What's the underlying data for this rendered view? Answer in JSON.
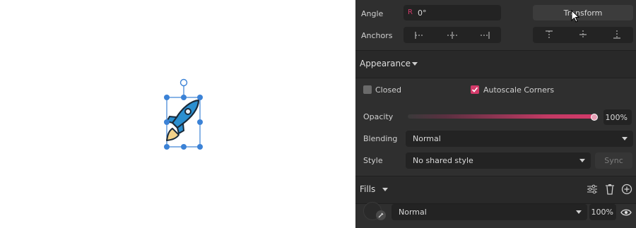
{
  "transform": {
    "angle_label": "Angle",
    "angle_prefix": "R",
    "angle_value": "0°",
    "transform_button": "Transform",
    "anchors_label": "Anchors"
  },
  "appearance": {
    "title": "Appearance",
    "closed_label": "Closed",
    "autoscale_label": "Autoscale Corners",
    "autoscale_checked": true,
    "opacity_label": "Opacity",
    "opacity_value": "100%",
    "blending_label": "Blending",
    "blending_value": "Normal",
    "style_label": "Style",
    "style_value": "No shared style",
    "sync_button": "Sync"
  },
  "fills": {
    "title": "Fills",
    "blend_value": "Normal",
    "opacity_value": "100%"
  },
  "colors": {
    "accent": "#d43a6a",
    "panel_bg": "#2f2f2f",
    "selection": "#3b82d6"
  }
}
